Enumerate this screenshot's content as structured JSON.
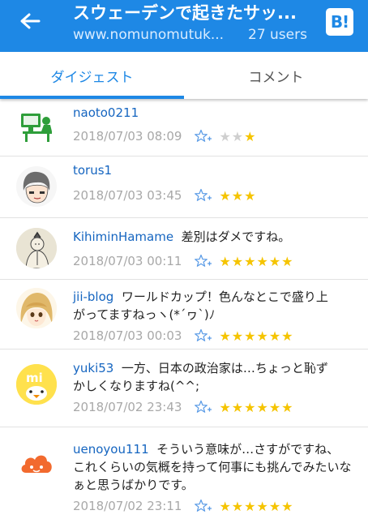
{
  "header": {
    "title": "スウェーデンで起きたサッ...",
    "domain": "www.nomunomutuk...",
    "users": "27 users",
    "hatena_icon_text": "B!",
    "bg_color": "#1e88e5"
  },
  "tabs": [
    {
      "label": "ダイジェスト",
      "active": true
    },
    {
      "label": "コメント",
      "active": false
    }
  ],
  "comments": [
    {
      "user": "naoto0211",
      "text": "",
      "text_line2": "",
      "time": "2018/07/03 08:09",
      "stars_gray": "★★",
      "stars_yellow": "★",
      "star_count": 1,
      "avatar": "pc-user-icon"
    },
    {
      "user": "torus1",
      "text": "",
      "text_line2": "",
      "time": "2018/07/03 03:45",
      "stars_gray": "",
      "stars_yellow": "★★★",
      "star_count": 3,
      "avatar": "cartoon-face"
    },
    {
      "user": "KihiminHamame",
      "text": "差別はダメですね。",
      "text_line2": "",
      "time": "2018/07/03 00:11",
      "stars_gray": "",
      "stars_yellow": "★★★★★★",
      "star_count": 6,
      "avatar": "sketch-portrait"
    },
    {
      "user": "jii-blog",
      "text": "ワールドカップ！色んなとこで盛り上",
      "text_line2": "がってますねっヽ(*´ヮ`)ﾉ",
      "time": "2018/07/03 00:03",
      "stars_gray": "",
      "stars_yellow": "★★★★★★",
      "star_count": 6,
      "avatar": "anime-girl"
    },
    {
      "user": "yuki53",
      "text": "一方、日本の政治家は…ちょっと恥ず",
      "text_line2": "かしくなりますね(^^;",
      "time": "2018/07/02 23:43",
      "stars_gray": "",
      "stars_yellow": "★★★★★★",
      "star_count": 6,
      "avatar": "mi-duck"
    },
    {
      "user": "uenoyou111",
      "text": "そういう意味が…さすがですね、",
      "text_line2": "これくらいの気概を持って何事にも挑んでみたいなぁと思うばかりです。",
      "time": "2018/07/02 23:11",
      "stars_gray": "",
      "stars_yellow": "★★★★★★",
      "star_count": 6,
      "avatar": "orange-cloud"
    }
  ]
}
